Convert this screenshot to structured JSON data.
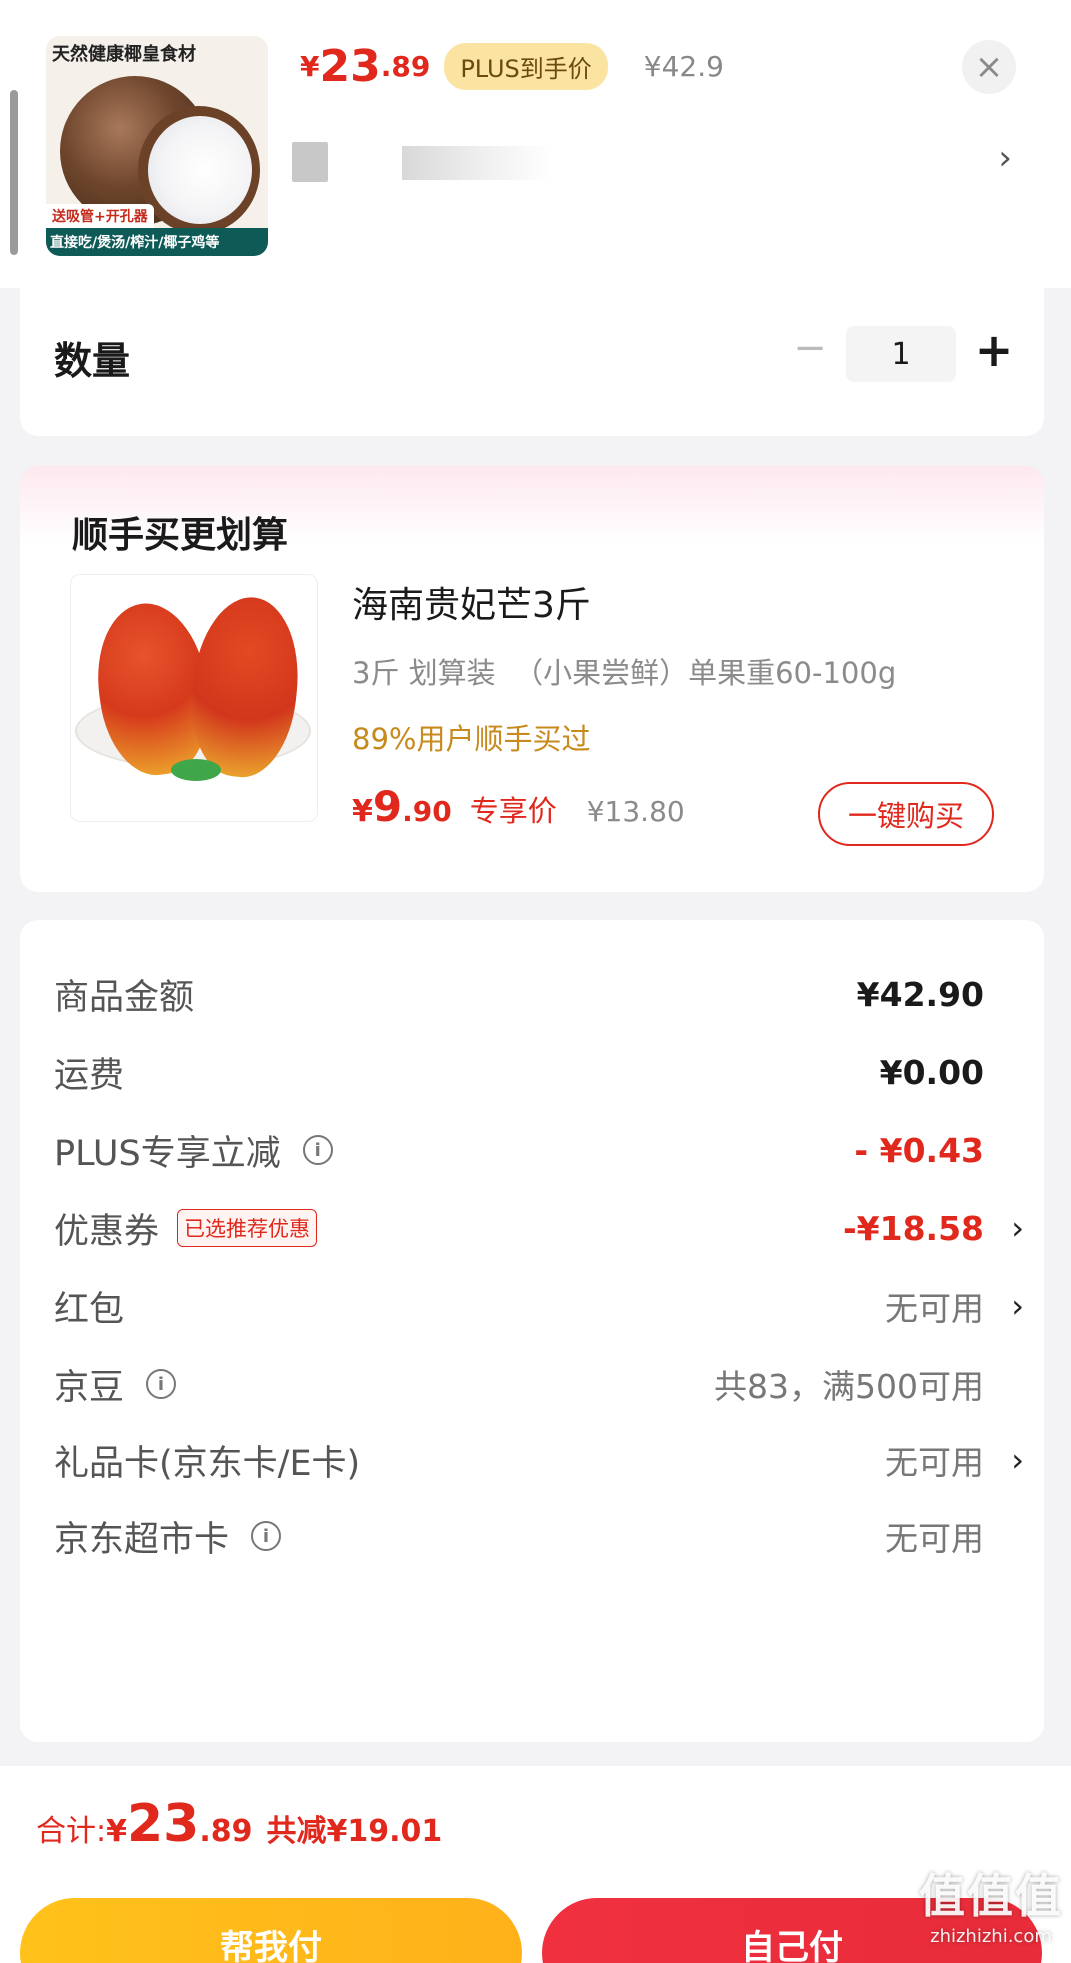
{
  "product": {
    "image_title": "天然健康椰皇食材",
    "image_tag1": "送吸管+开孔器",
    "image_tag2": "直接吃/煲汤/榨汁/椰子鸡等",
    "price_symbol": "¥",
    "price_int": "23",
    "price_dec": ".89",
    "plus_badge": "PLUS到手价",
    "original_price": "¥42.9",
    "close_icon": "×",
    "spec_chevron": "›"
  },
  "quantity": {
    "label": "数量",
    "minus": "−",
    "value": "1",
    "plus": "+"
  },
  "upsell": {
    "title": "顺手买更划算",
    "name": "海南贵妃芒3斤",
    "spec": "3斤 划算装  （小果尝鲜）单果重60-100g",
    "social": "89%用户顺手买过",
    "price_symbol": "¥",
    "price_int": "9",
    "price_dec": ".90",
    "price_tag": "专享价",
    "original_price": "¥13.80",
    "buy_button": "一键购买"
  },
  "summary": {
    "rows": [
      {
        "label": "商品金额",
        "value": "¥42.90"
      },
      {
        "label": "运费",
        "value": "¥0.00"
      },
      {
        "label": "PLUS专享立减",
        "value": "- ¥0.43"
      },
      {
        "label": "优惠券",
        "tag": "已选推荐优惠",
        "value": "-¥18.58"
      },
      {
        "label": "红包",
        "value": "无可用"
      },
      {
        "label": "京豆",
        "value": "共83，满500可用"
      },
      {
        "label": "礼品卡(京东卡/E卡)",
        "value": "无可用"
      },
      {
        "label": "京东超市卡",
        "value": "无可用"
      }
    ],
    "info_icon": "i",
    "chevron": "›"
  },
  "footer": {
    "total_label": "合计: ",
    "total_symbol": "¥",
    "total_int": "23",
    "total_dec": ".89",
    "total_saved": "共减¥19.01",
    "help_pay": "帮我付",
    "self_pay": "自己付"
  },
  "watermark": {
    "logo": "值值值",
    "site": "zhizhizhi.com"
  },
  "colors": {
    "accent_red": "#e0281d",
    "plus_gold": "#fbe3a1",
    "help_yellow": "#ffc21a",
    "pay_red": "#f0303e"
  }
}
